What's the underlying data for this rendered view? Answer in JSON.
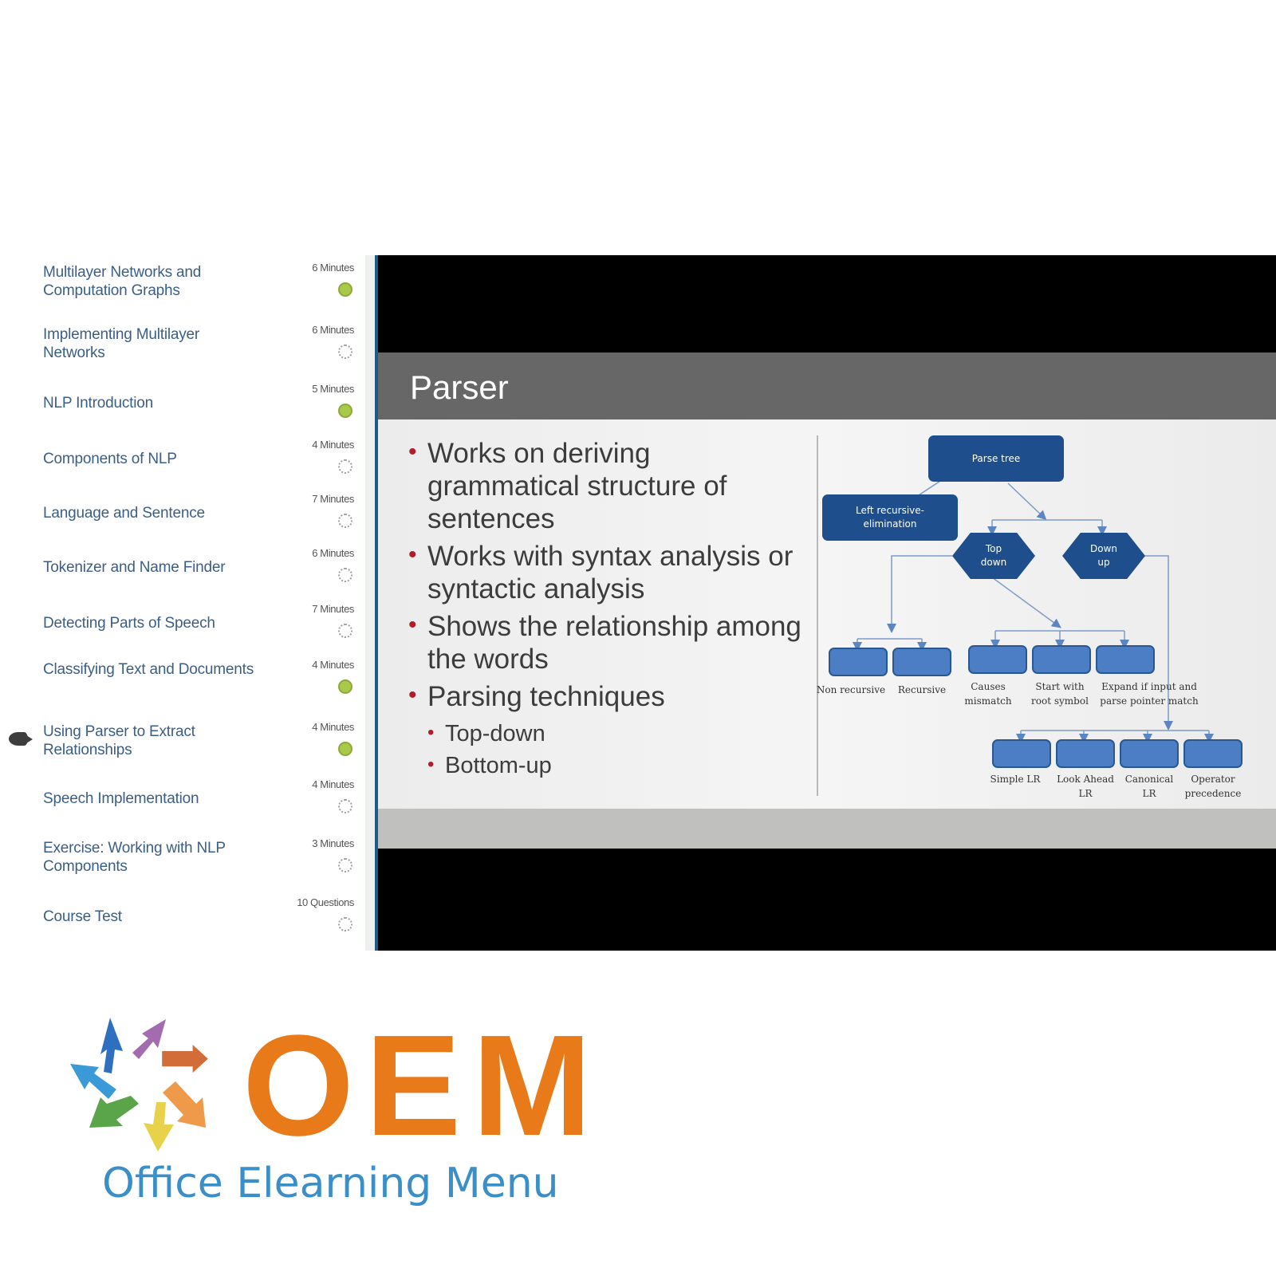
{
  "sidebar": {
    "current_index": 8,
    "items": [
      {
        "title": "Multilayer Networks and Computation Graphs",
        "duration": "6 Minutes",
        "status": "completed"
      },
      {
        "title": "Implementing Multilayer Networks",
        "duration": "6 Minutes",
        "status": "not-started"
      },
      {
        "title": "NLP Introduction",
        "duration": "5 Minutes",
        "status": "completed"
      },
      {
        "title": "Components of NLP",
        "duration": "4 Minutes",
        "status": "not-started"
      },
      {
        "title": "Language and Sentence",
        "duration": "7 Minutes",
        "status": "not-started"
      },
      {
        "title": "Tokenizer and Name Finder",
        "duration": "6 Minutes",
        "status": "not-started"
      },
      {
        "title": "Detecting Parts of Speech",
        "duration": "7 Minutes",
        "status": "not-started"
      },
      {
        "title": "Classifying Text and Documents",
        "duration": "4 Minutes",
        "status": "completed"
      },
      {
        "title": "Using Parser to Extract Relationships",
        "duration": "4 Minutes",
        "status": "completed"
      },
      {
        "title": "Speech Implementation",
        "duration": "4 Minutes",
        "status": "not-started"
      },
      {
        "title": "Exercise: Working with NLP Components",
        "duration": "3 Minutes",
        "status": "not-started"
      },
      {
        "title": "Course Test",
        "duration": "10 Questions",
        "status": "not-started"
      }
    ]
  },
  "slide": {
    "title": "Parser",
    "bullets": [
      "Works on deriving grammatical structure of sentences",
      "Works with syntax analysis or syntactic analysis",
      "Shows the relationship among the words",
      "Parsing techniques"
    ],
    "sub_bullets": [
      "Top-down",
      "Bottom-up"
    ],
    "diagram": {
      "root": "Parse tree",
      "left_node": "Left recursive-elimination",
      "top_down": "Top down",
      "down_up": "Down up",
      "left_leaves": [
        "Non recursive",
        "Recursive"
      ],
      "top_down_leaves": [
        "Causes mismatch",
        "Start with root symbol",
        "Expand if input and parse pointer match"
      ],
      "down_up_leaves": [
        "Simple LR",
        "Look Ahead LR",
        "Canonical LR",
        "Operator precedence"
      ]
    }
  },
  "logo": {
    "mark": "OEM",
    "tagline": "Office Elearning Menu",
    "colors": {
      "mark": "#e87a1a",
      "tagline": "#3a8fc8"
    }
  }
}
